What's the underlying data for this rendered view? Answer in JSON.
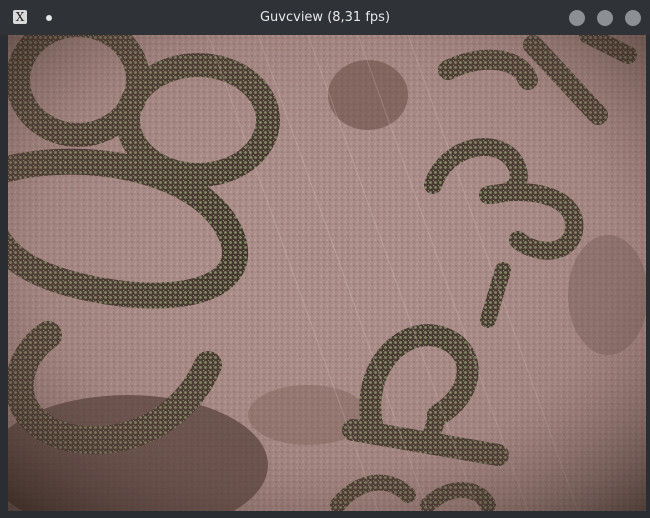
{
  "window": {
    "title": "Guvcview (8,31 fps)",
    "app_icon_glyph": "X"
  },
  "controls": {
    "minimize_icon": "minimize-circle-icon",
    "maximize_icon": "maximize-circle-icon",
    "close_icon": "close-circle-icon"
  },
  "video": {
    "content": "live microscope camera frame",
    "palette": {
      "base": "#a88a86",
      "dark": "#3a2e25",
      "mid": "#7a6355",
      "light": "#d9c7c3",
      "highlight": "#9fb38a"
    }
  }
}
